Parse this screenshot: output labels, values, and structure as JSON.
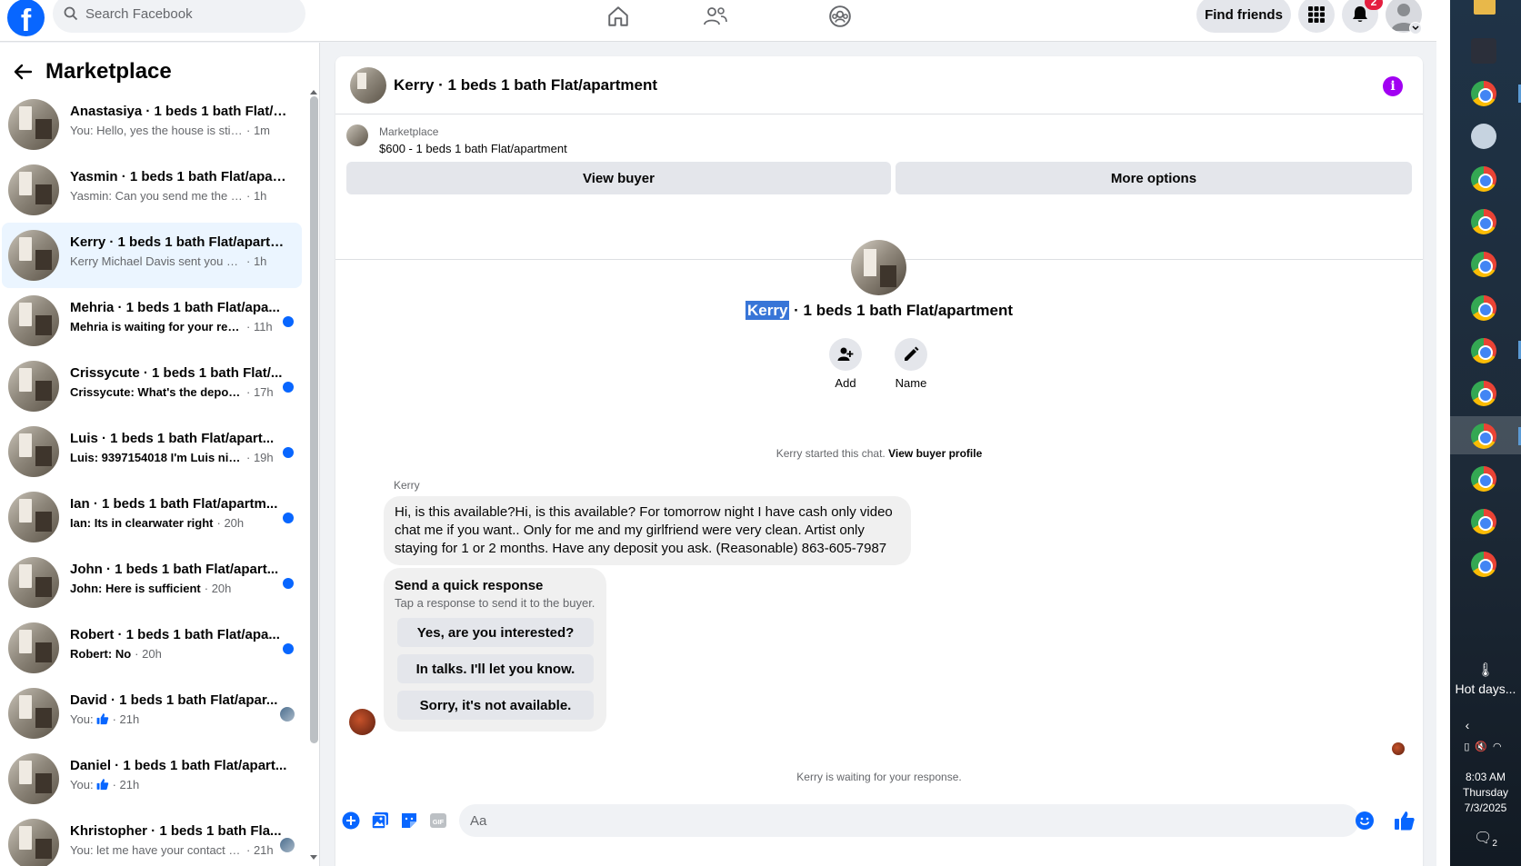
{
  "topnav": {
    "logo": "f",
    "search_placeholder": "Search Facebook",
    "find_friends": "Find friends",
    "notification_count": "2",
    "icons": [
      "home-icon",
      "friends-icon",
      "groups-icon",
      "menu-grid-icon",
      "bell-icon",
      "profile-icon"
    ]
  },
  "sidebar": {
    "title": "Marketplace",
    "conversations": [
      {
        "name": "Anastasiya · 1 beds 1 bath Flat/a...",
        "preview": "You: Hello, yes the house is still av...",
        "time": "· 1m",
        "unread": false
      },
      {
        "name": "Yasmin · 1 beds 1 bath Flat/apart...",
        "preview": "Yasmin: Can you send me the addr...",
        "time": "· 1h",
        "unread": false
      },
      {
        "name": "Kerry · 1 beds 1 bath Flat/apartm...",
        "preview": "Kerry Michael Davis sent you a mes...",
        "time": "· 1h",
        "unread": false,
        "active": true
      },
      {
        "name": "Mehria · 1 beds 1 bath Flat/apa...",
        "preview": "Mehria is waiting for your resp...",
        "time": "· 11h",
        "unread": true
      },
      {
        "name": "Crissycute · 1 beds 1 bath Flat/...",
        "preview": "Crissycute: What's the deposit ...",
        "time": "· 17h",
        "unread": true
      },
      {
        "name": "Luis · 1 beds 1 bath Flat/apart...",
        "preview": "Luis: 9397154018 I'm Luis nice t...",
        "time": "· 19h",
        "unread": true
      },
      {
        "name": "Ian · 1 beds 1 bath Flat/apartm...",
        "preview": "Ian: Its in clearwater right",
        "time": "· 20h",
        "unread": true
      },
      {
        "name": "John · 1 beds 1 bath Flat/apart...",
        "preview": "John: Here is sufficient",
        "time": "· 20h",
        "unread": true
      },
      {
        "name": "Robert · 1 beds 1 bath Flat/apa...",
        "preview": "Robert: No",
        "time": "· 20h",
        "unread": true
      },
      {
        "name": "David · 1 beds 1 bath Flat/apar...",
        "preview": "You:",
        "time": "· 21h",
        "unread": false,
        "thumb": true,
        "seen": true
      },
      {
        "name": "Daniel · 1 beds 1 bath Flat/apart...",
        "preview": "You:",
        "time": "· 21h",
        "unread": false,
        "thumb": true
      },
      {
        "name": "Khristopher · 1 beds 1 bath Fla...",
        "preview": "You: let me have your contact n...",
        "time": "· 21h",
        "unread": false,
        "seen": true
      }
    ]
  },
  "chat": {
    "header_title": "Kerry · 1 beds 1 bath Flat/apartment",
    "marketplace_label": "Marketplace",
    "listing_price": "$600 - 1 beds 1 bath Flat/apartment",
    "view_buyer": "View buyer",
    "more_options": "More options",
    "center_name_highlight": "Kerry",
    "center_name_rest": " · 1 beds 1 bath Flat/apartment",
    "add_label": "Add",
    "name_label": "Name",
    "started_text": "Kerry started this chat.",
    "view_buyer_profile": "View buyer profile",
    "sender": "Kerry",
    "message": "Hi, is this available?Hi, is this available? For tomorrow night I have cash only video chat me if you want.. Only for me and my girlfriend were very clean. Artist only staying for 1 or 2 months. Have any deposit you ask. (Reasonable) 863-605-7987",
    "quick_title": "Send a quick response",
    "quick_sub": "Tap a response to send it to the buyer.",
    "quick_responses": [
      "Yes, are you interested?",
      "In talks. I'll let you know.",
      "Sorry, it's not available."
    ],
    "waiting_text": "Kerry is waiting for your response.",
    "composer_placeholder": "Aa"
  },
  "taskbar": {
    "weather": "Hot days...",
    "time": "8:03 AM",
    "day": "Thursday",
    "date": "7/3/2025",
    "notif_count": "2"
  }
}
